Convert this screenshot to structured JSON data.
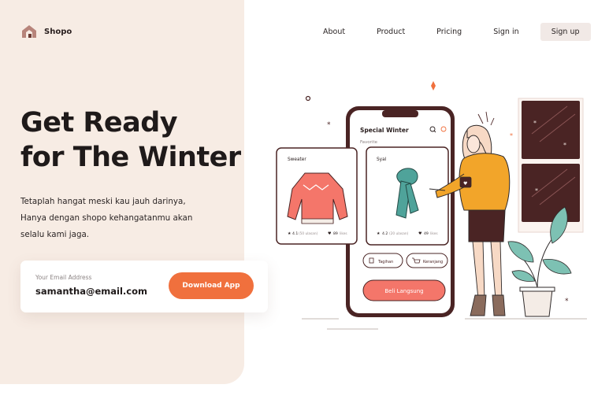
{
  "brand": {
    "name": "Shopo"
  },
  "nav": {
    "items": [
      "About",
      "Product",
      "Pricing",
      "Sign in"
    ],
    "signup_label": "Sign up"
  },
  "hero": {
    "title_lines": [
      "Get Ready",
      "for The Winter"
    ],
    "subtitle_lines": [
      "Tetaplah hangat meski kau jauh darinya,",
      "Hanya dengan shopo kehangatanmu akan",
      "selalu kami jaga."
    ]
  },
  "email_form": {
    "label": "Your Email Address",
    "value": "samantha@email.com",
    "button_label": "Download App"
  },
  "phone": {
    "title": "Special Winter",
    "subtitle": "Favorite",
    "card_sweater": {
      "label": "Sweater",
      "rating": "4.1",
      "reviews": "(50 ulasan)",
      "likes": "89",
      "likes_label": "likes"
    },
    "card_syal": {
      "label": "Syal",
      "rating": "4.2",
      "reviews": "(20 ulasan)",
      "likes": "49",
      "likes_label": "likes"
    },
    "chip_1": "Tagihan",
    "chip_2": "Keranjang",
    "buy_button": "Beli Langsung"
  },
  "colors": {
    "accent": "#f0703d",
    "left_bg": "#f7ece4",
    "primary_dark": "#4a2424",
    "pink": "#f4766a",
    "teal": "#4fa39a",
    "yellow": "#f2a52a"
  },
  "icons": [
    "logo-icon",
    "search-icon",
    "refresh-icon",
    "star-icon",
    "heart-icon",
    "receipt-icon",
    "cart-icon"
  ]
}
